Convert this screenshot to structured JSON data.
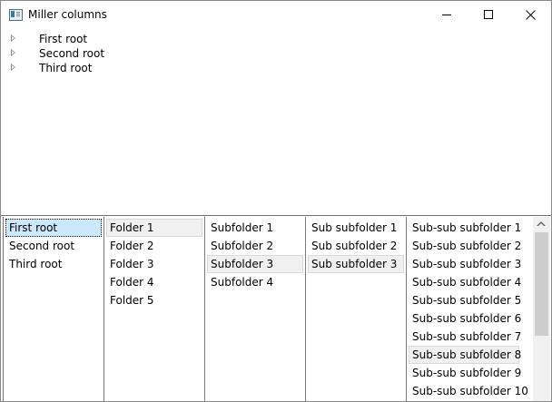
{
  "window": {
    "title": "Miller columns"
  },
  "tree": {
    "items": [
      {
        "label": "First root"
      },
      {
        "label": "Second root"
      },
      {
        "label": "Third root"
      }
    ]
  },
  "columns": [
    {
      "items": [
        "First root",
        "Second root",
        "Third root"
      ],
      "selected": 0,
      "focused": true
    },
    {
      "items": [
        "Folder 1",
        "Folder 2",
        "Folder 3",
        "Folder 4",
        "Folder 5"
      ],
      "selected": 0
    },
    {
      "items": [
        "Subfolder 1",
        "Subfolder 2",
        "Subfolder 3",
        "Subfolder 4"
      ],
      "selected": 2
    },
    {
      "items": [
        "Sub subfolder 1",
        "Sub subfolder 2",
        "Sub subfolder 3"
      ],
      "selected": 2
    },
    {
      "items": [
        "Sub-sub subfolder 1",
        "Sub-sub subfolder 2",
        "Sub-sub subfolder 3",
        "Sub-sub subfolder 4",
        "Sub-sub subfolder 5",
        "Sub-sub subfolder 6",
        "Sub-sub subfolder 7",
        "Sub-sub subfolder 8",
        "Sub-sub subfolder 9",
        "Sub-sub subfolder 10"
      ],
      "selected": 7
    }
  ],
  "colors": {
    "focus_selection": "#cce8ff",
    "inactive_selection": "#f0f0f0",
    "accent_border": "#3f7fbf"
  },
  "icons": [
    "app-icon",
    "minimize-icon",
    "maximize-icon",
    "close-icon",
    "expand-arrow-icon",
    "scroll-up-arrow-icon"
  ]
}
